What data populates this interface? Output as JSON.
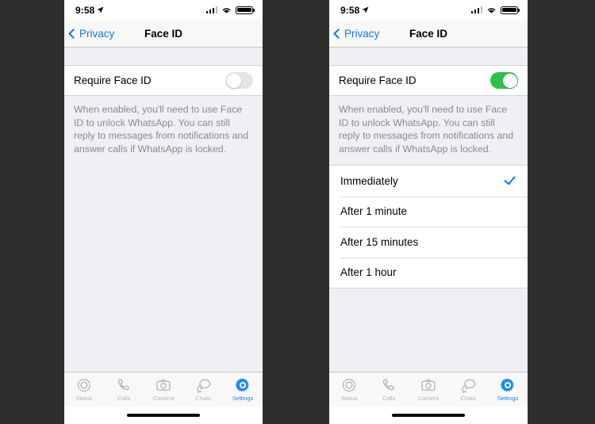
{
  "background_color": "#2e2e2e",
  "accent_color": "#1178e8",
  "toggle_on_color": "#2ec14e",
  "panels": [
    {
      "id": "left",
      "status_bar": {
        "time": "9:58",
        "location_icon": "location-arrow-icon",
        "signal_icon": "cellular-signal-icon",
        "wifi_icon": "wifi-icon",
        "battery_icon": "battery-full-icon"
      },
      "nav": {
        "back_label": "Privacy",
        "back_icon": "chevron-left-icon",
        "title": "Face ID"
      },
      "settings_row": {
        "label": "Require Face ID",
        "toggle_state": "off"
      },
      "note": "When enabled, you'll need to use Face ID to unlock WhatsApp. You can still reply to messages from notifications and answer calls if WhatsApp is locked.",
      "options": [],
      "tabs": [
        {
          "label": "Status",
          "icon": "status-rings-icon",
          "active": false
        },
        {
          "label": "Calls",
          "icon": "phone-icon",
          "active": false
        },
        {
          "label": "Camera",
          "icon": "camera-icon",
          "active": false
        },
        {
          "label": "Chats",
          "icon": "chat-bubbles-icon",
          "active": false
        },
        {
          "label": "Settings",
          "icon": "gear-icon",
          "active": true
        }
      ]
    },
    {
      "id": "right",
      "status_bar": {
        "time": "9:58",
        "location_icon": "location-arrow-icon",
        "signal_icon": "cellular-signal-icon",
        "wifi_icon": "wifi-icon",
        "battery_icon": "battery-full-icon"
      },
      "nav": {
        "back_label": "Privacy",
        "back_icon": "chevron-left-icon",
        "title": "Face ID"
      },
      "settings_row": {
        "label": "Require Face ID",
        "toggle_state": "on"
      },
      "note": "When enabled, you'll need to use Face ID to unlock WhatsApp. You can still reply to messages from notifications and answer calls if WhatsApp is locked.",
      "options": [
        {
          "label": "Immediately",
          "selected": true
        },
        {
          "label": "After 1 minute",
          "selected": false
        },
        {
          "label": "After 15 minutes",
          "selected": false
        },
        {
          "label": "After 1 hour",
          "selected": false
        }
      ],
      "tabs": [
        {
          "label": "Status",
          "icon": "status-rings-icon",
          "active": false
        },
        {
          "label": "Calls",
          "icon": "phone-icon",
          "active": false
        },
        {
          "label": "Camera",
          "icon": "camera-icon",
          "active": false
        },
        {
          "label": "Chats",
          "icon": "chat-bubbles-icon",
          "active": false
        },
        {
          "label": "Settings",
          "icon": "gear-icon",
          "active": true
        }
      ]
    }
  ]
}
